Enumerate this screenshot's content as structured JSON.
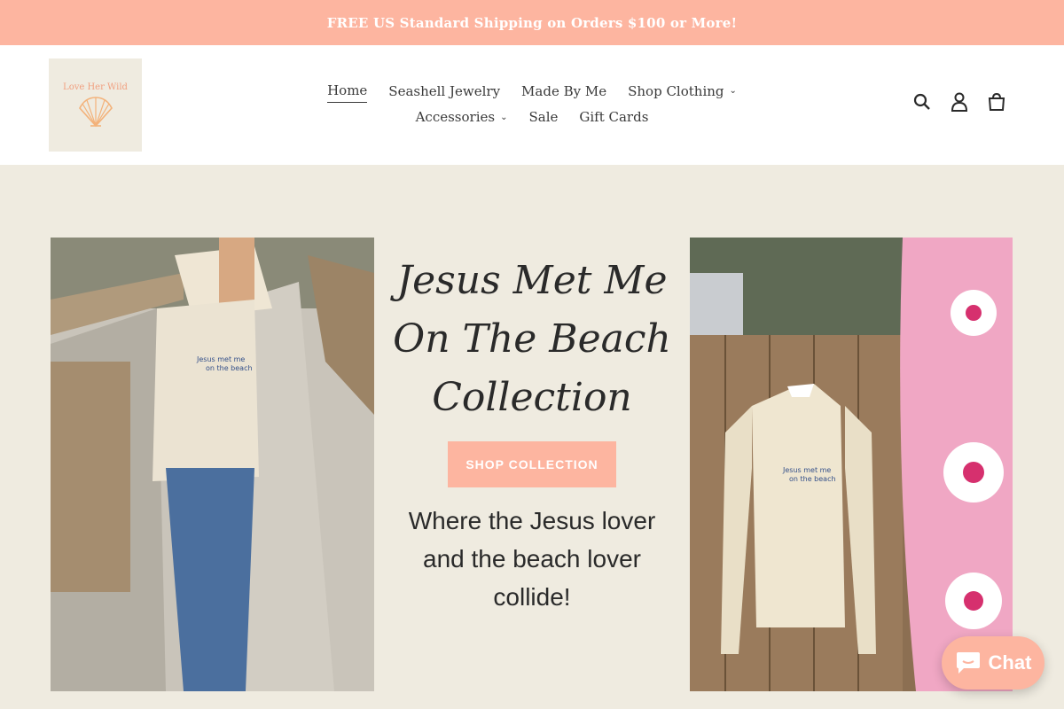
{
  "announcement": "FREE US Standard Shipping on Orders $100 or More!",
  "logo": {
    "text": "Love Her Wild",
    "icon": "seashell-icon"
  },
  "nav": {
    "row1": [
      {
        "label": "Home",
        "active": true,
        "dropdown": false
      },
      {
        "label": "Seashell Jewelry",
        "dropdown": false
      },
      {
        "label": "Made By Me",
        "dropdown": false
      },
      {
        "label": "Shop Clothing",
        "dropdown": true
      }
    ],
    "row2": [
      {
        "label": "Accessories",
        "dropdown": true
      },
      {
        "label": "Sale",
        "dropdown": false
      },
      {
        "label": "Gift Cards",
        "dropdown": false
      }
    ]
  },
  "header_icons": [
    "search-icon",
    "account-icon",
    "cart-icon"
  ],
  "hero": {
    "headline": [
      "Jesus Met Me",
      "On The Beach",
      "Collection"
    ],
    "cta": "SHOP COLLECTION",
    "tagline": [
      "Where the Jesus lover",
      "and the beach lover",
      "collide!"
    ],
    "tote_print": [
      "Jesus met me",
      "on the beach"
    ],
    "sweatshirt_print": [
      "Jesus met me",
      "on the beach"
    ]
  },
  "chat": {
    "label": "Chat",
    "icon": "chat-bubble-icon"
  },
  "colors": {
    "accent": "#fdb5a0",
    "background": "#efebe0",
    "text": "#2a2a2a"
  }
}
